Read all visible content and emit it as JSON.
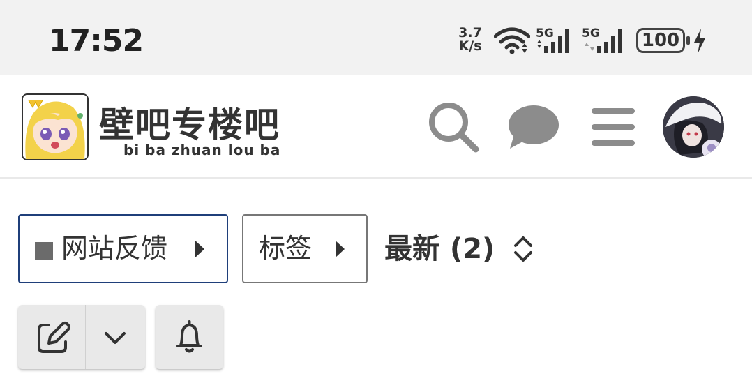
{
  "status_bar": {
    "time": "17:52",
    "net_speed_value": "3.7",
    "net_speed_unit": "K/s",
    "signal_1_label": "5G",
    "signal_2_label": "5G",
    "battery": "100"
  },
  "header": {
    "site_title": "壁吧专楼吧",
    "site_subtitle": "bi ba zhuan lou ba",
    "icons": [
      "search-icon",
      "chat-icon",
      "menu-icon"
    ]
  },
  "controls": {
    "category_label": "网站反馈",
    "category_color": "#6b6b6b",
    "tags_label": "标签",
    "sort_label": "最新 (2)"
  },
  "actions": {
    "icons": [
      "edit-icon",
      "chevron-down-icon",
      "bell-icon"
    ]
  },
  "colors": {
    "accent_border": "#1f3f7a",
    "status_bar_bg": "#f2f2f2",
    "icon_gray": "#8c8c8c"
  }
}
